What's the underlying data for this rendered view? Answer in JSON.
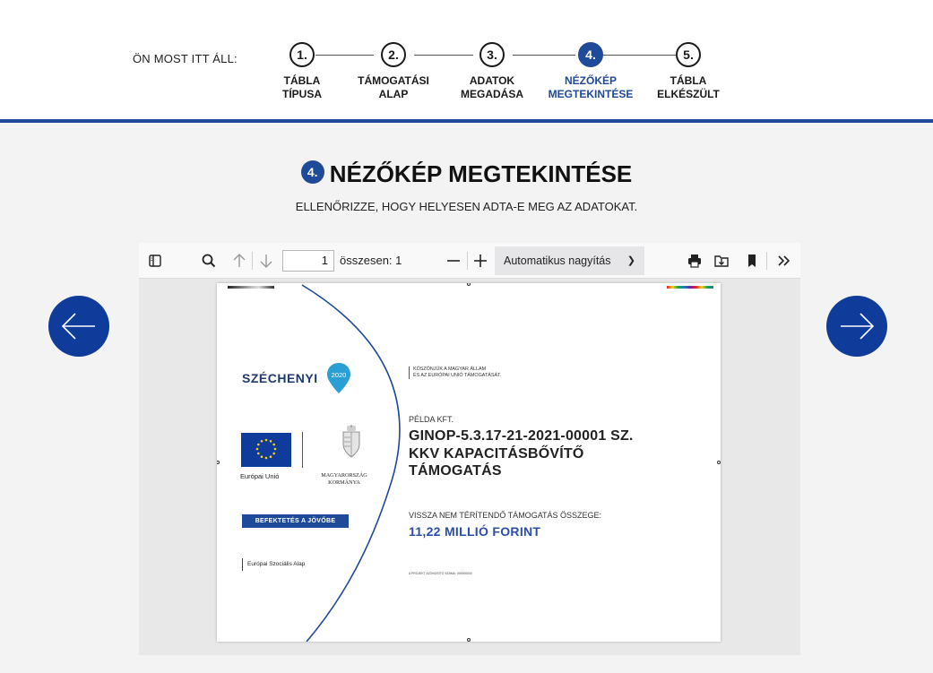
{
  "stepper": {
    "where_label": "ÖN MOST ITT ÁLL:",
    "steps": [
      {
        "number": "1.",
        "label_line1": "TÁBLA",
        "label_line2": "TÍPUSA"
      },
      {
        "number": "2.",
        "label_line1": "TÁMOGATÁSI",
        "label_line2": "ALAP"
      },
      {
        "number": "3.",
        "label_line1": "ADATOK",
        "label_line2": "MEGADÁSA"
      },
      {
        "number": "4.",
        "label_line1": "NÉZŐKÉP",
        "label_line2": "MEGTEKINTÉSE"
      },
      {
        "number": "5.",
        "label_line1": "TÁBLA",
        "label_line2": "ELKÉSZÜLT"
      }
    ],
    "active_step": 4
  },
  "page": {
    "badge": "4.",
    "title": "NÉZŐKÉP MEGTEKINTÉSE",
    "subtitle": "ELLENŐRIZZE, HOGY HELYESEN ADTA-E MEG AZ ADATOKAT."
  },
  "viewer": {
    "page_number": "1",
    "total_pages": "összesen: 1",
    "zoom": "Automatikus nagyítás",
    "icons": [
      "sidebar-icon",
      "search-icon",
      "arrow-up-icon",
      "arrow-down-icon",
      "minus-icon",
      "plus-icon",
      "print-icon",
      "save-icon",
      "bookmark-icon",
      "more-icon"
    ]
  },
  "document": {
    "logo_text": "SZÉCHENYI",
    "logo_year": "2020",
    "eu_text": "Európai Unió",
    "hu_text_line1": "MAGYARORSZÁG",
    "hu_text_line2": "KORMÁNYA",
    "befektetes": "BEFEKTETÉS A JÖVŐBE",
    "esza": "Európai Szociális Alap",
    "thanks_line1": "KÖSZÖNJÜK A MAGYAR ÁLLAM",
    "thanks_line2": "ÉS AZ EURÓPAI UNIÓ TÁMOGATÁSÁT.",
    "company": "PÉLDA KFT.",
    "project_line1": "GINOP-5.3.17-21-2021-00001 SZ.",
    "project_line2": "KKV KAPACITÁSBŐVÍTŐ",
    "project_line3": "TÁMOGATÁS",
    "support_label": "VISSZA NEM TÉRÍTENDŐ TÁMOGATÁS ÖSSZEGE:",
    "support_value": "11,22 MILLIÓ FORINT",
    "project_id": "A PROJEKT AZONOSÍTÓ SZÁMA: 000000000"
  },
  "colors": {
    "brand_blue": "#1e4a99",
    "nav_blue": "#0f3c9a",
    "amount_blue": "#2a4fa3"
  }
}
